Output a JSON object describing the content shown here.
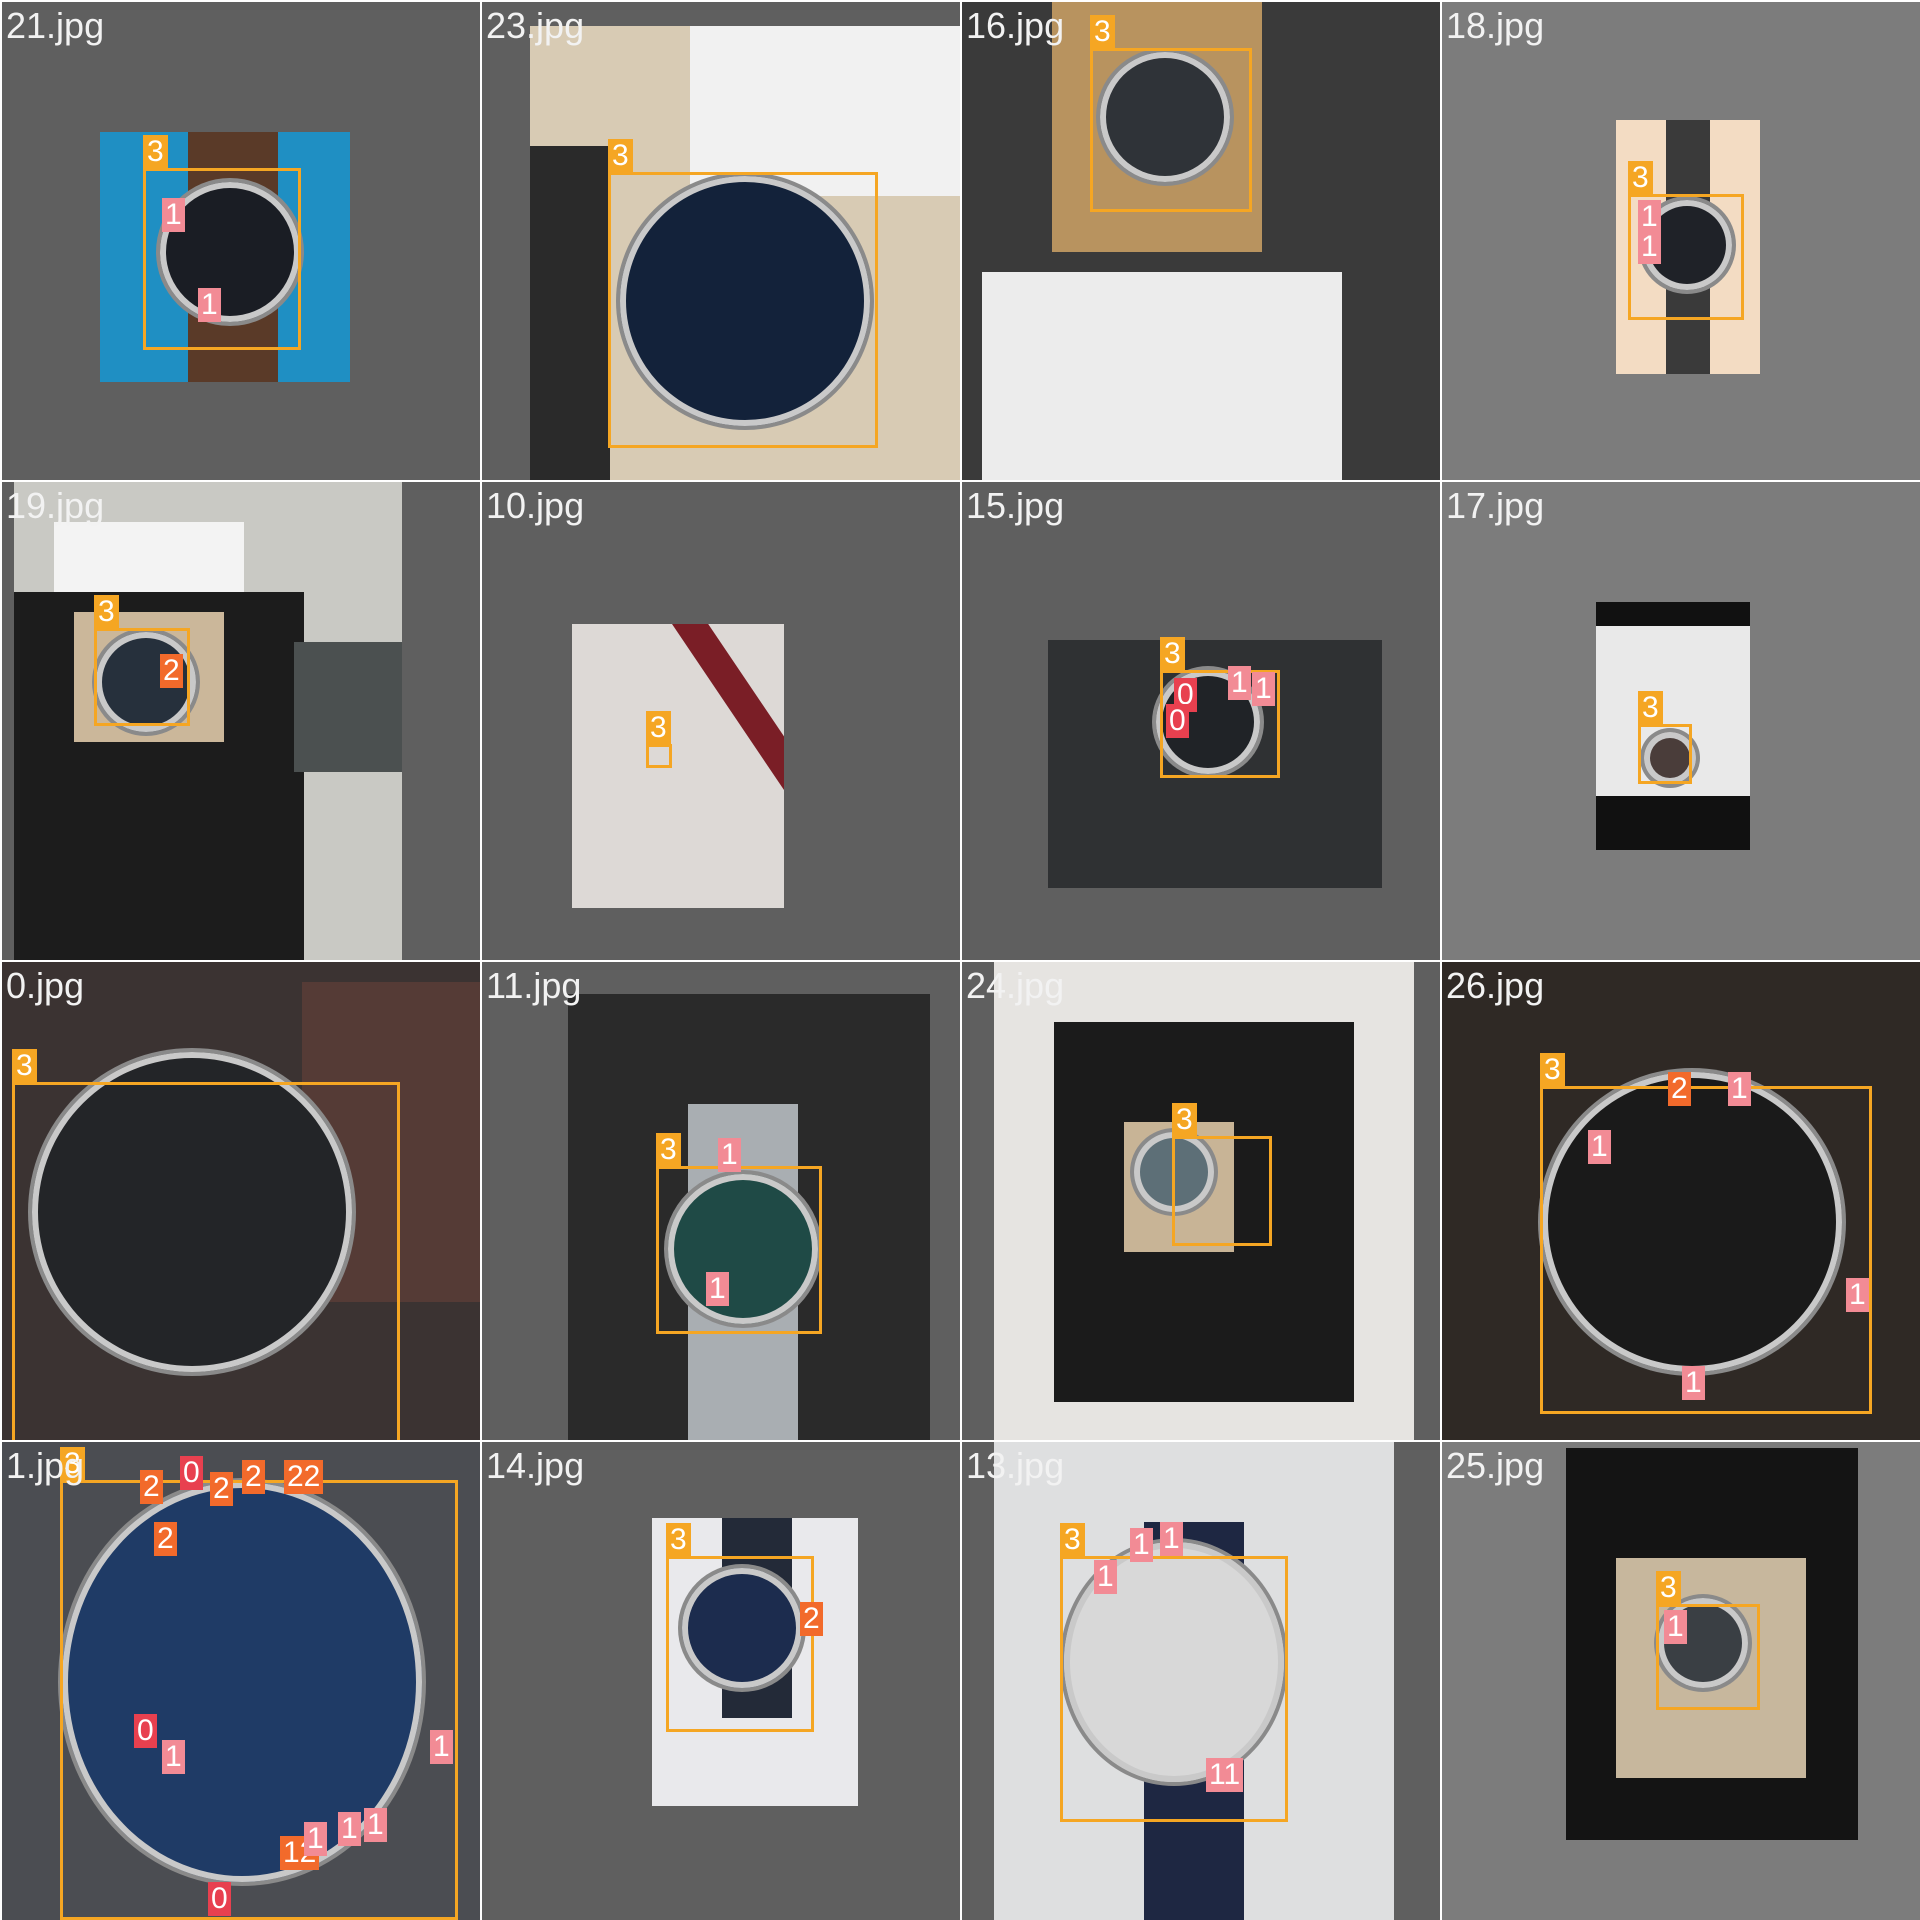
{
  "grid": {
    "cells": [
      {
        "file": "21.jpg",
        "labels": [
          "3",
          "1",
          "1"
        ]
      },
      {
        "file": "23.jpg",
        "labels": [
          "3"
        ]
      },
      {
        "file": "16.jpg",
        "labels": [
          "3"
        ]
      },
      {
        "file": "18.jpg",
        "labels": [
          "3",
          "1",
          "1"
        ]
      },
      {
        "file": "19.jpg",
        "labels": [
          "3",
          "2"
        ]
      },
      {
        "file": "10.jpg",
        "labels": [
          "3"
        ]
      },
      {
        "file": "15.jpg",
        "labels": [
          "3",
          "0",
          "0",
          "1",
          "1"
        ]
      },
      {
        "file": "17.jpg",
        "labels": [
          "3"
        ]
      },
      {
        "file": "0.jpg",
        "labels": [
          "3"
        ]
      },
      {
        "file": "11.jpg",
        "labels": [
          "3",
          "1",
          "1"
        ]
      },
      {
        "file": "24.jpg",
        "labels": [
          "3"
        ]
      },
      {
        "file": "26.jpg",
        "labels": [
          "3",
          "2",
          "1",
          "1",
          "1",
          "1"
        ]
      },
      {
        "file": "1.jpg",
        "labels": [
          "3",
          "2",
          "2",
          "0",
          "2",
          "2",
          "22",
          "0",
          "1",
          "1",
          "12",
          "1",
          "1",
          "1",
          "0"
        ]
      },
      {
        "file": "14.jpg",
        "labels": [
          "3",
          "2"
        ]
      },
      {
        "file": "13.jpg",
        "labels": [
          "3",
          "1",
          "1",
          "1",
          "11"
        ]
      },
      {
        "file": "25.jpg",
        "labels": [
          "3",
          "1"
        ]
      }
    ]
  },
  "colors": {
    "box_class_3": "#f5a623",
    "label_class_1": "#f28b95",
    "label_class_0": "#e8404f",
    "label_class_2": "#f26a2b",
    "background_dark": "#5f5f5f",
    "background_light": "#7c7c7c"
  }
}
